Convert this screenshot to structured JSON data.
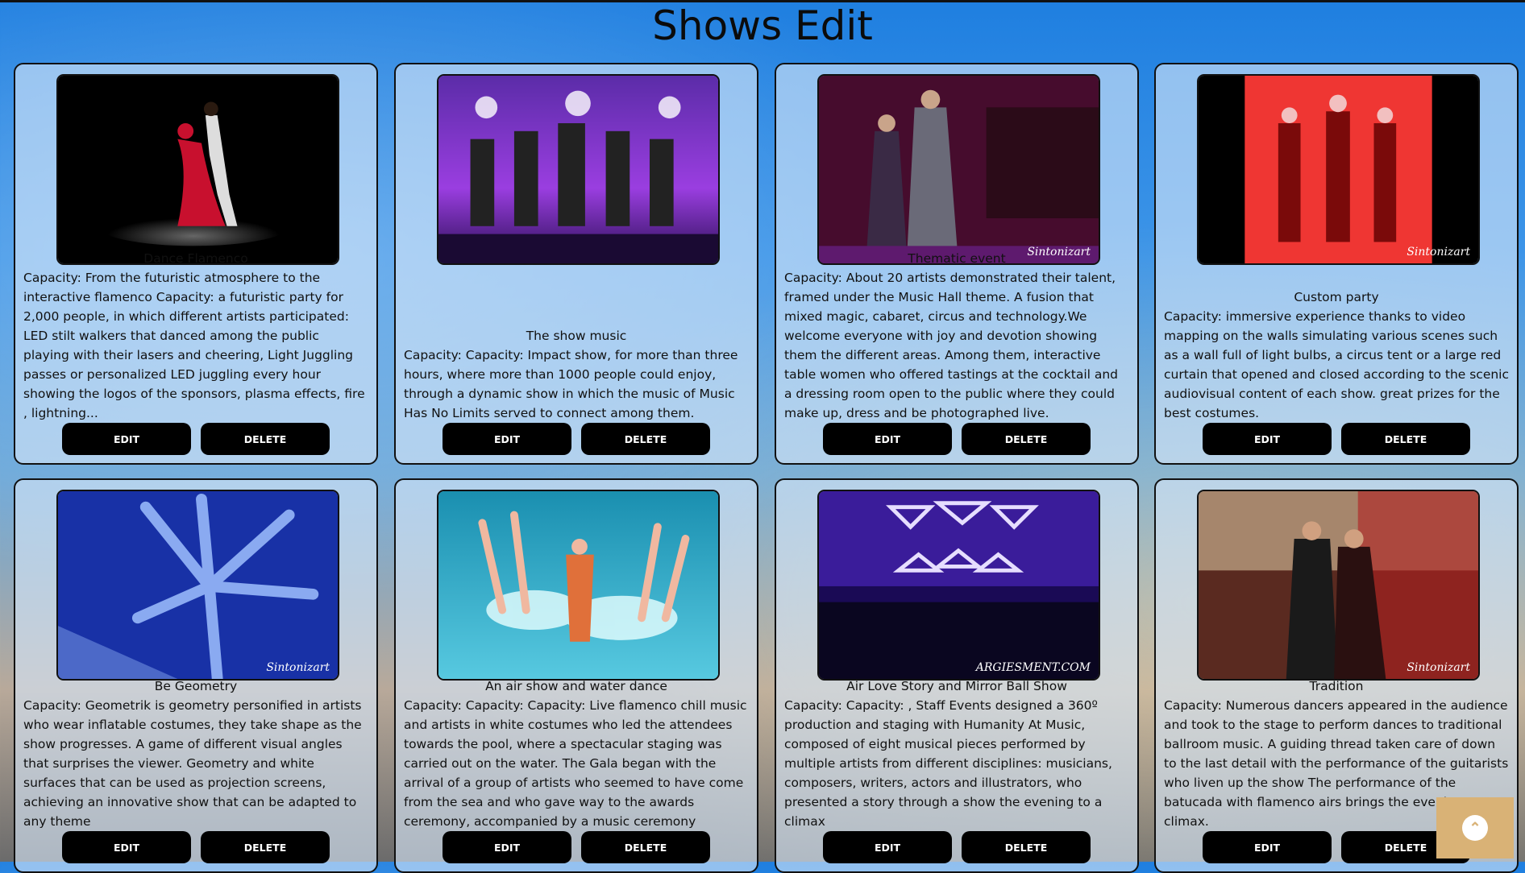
{
  "page": {
    "title": "Shows Edit"
  },
  "buttons": {
    "edit": "EDIT",
    "delete": "DELETE"
  },
  "shows": [
    {
      "name": "Dance Flamenco",
      "description": "Capacity: From the futuristic atmosphere to the interactive flamenco Capacity: a futuristic party for 2,000 people, in which different artists participated: LED stilt walkers that danced among the public playing with their lasers and cheering, Light Juggling passes or personalized LED juggling every hour showing the logos of the sponsors, plasma effects, fire , lightning...",
      "watermark": ""
    },
    {
      "name": "The show music",
      "description": "Capacity: Capacity: Impact show, for more than three hours, where more than 1000 people could enjoy, through a dynamic show in which the music of Music Has No Limits served to connect among them.",
      "watermark": ""
    },
    {
      "name": "Thematic event",
      "description": "Capacity: About 20 artists demonstrated their talent, framed under the Music Hall theme. A fusion that mixed magic, cabaret, circus and technology.We welcome everyone with joy and devotion showing them the different areas. Among them, interactive table women who offered tastings at the cocktail and a dressing room open to the public where they could make up, dress and be photographed live.",
      "watermark": "Sintonizart"
    },
    {
      "name": "Custom party",
      "description": "Capacity: immersive experience thanks to video mapping on the walls simulating various scenes such as a wall full of light bulbs, a circus tent or a large red curtain that opened and closed according to the scenic audiovisual content of each show. great prizes for the best costumes.",
      "watermark": "Sintonizart"
    },
    {
      "name": "Be Geometry",
      "description": "Capacity: Geometrik is geometry personified in artists who wear inflatable costumes, they take shape as the show progresses. A game of different visual angles that surprises the viewer. Geometry and white surfaces that can be used as projection screens, achieving an innovative show that can be adapted to any theme",
      "watermark": "Sintonizart"
    },
    {
      "name": "An air show and water dance",
      "description": "Capacity: Capacity: Capacity: Live flamenco chill music and artists in white costumes who led the attendees towards the pool, where a spectacular staging was carried out on the water. The Gala began with the arrival of a group of artists who seemed to have come from the sea and who gave way to the awards ceremony, accompanied by a music ceremony",
      "watermark": ""
    },
    {
      "name": "Air Love Story and Mirror Ball Show",
      "description": "Capacity: Capacity: , Staff Events designed a 360º production and staging with Humanity At Music, composed of eight musical pieces performed by multiple artists from different disciplines: musicians, composers, writers, actors and illustrators, who presented a story through a show the evening to a climax",
      "watermark": "ARGIESMENT.COM"
    },
    {
      "name": "Tradition",
      "description": "Capacity: Numerous dancers appeared in the audience and took to the stage to perform dances to traditional ballroom music. A guiding thread taken care of down to the last detail with the performance of the guitarists who liven up the show The performance of the batucada with flamenco airs brings the evening to a climax.",
      "watermark": "Sintonizart"
    }
  ],
  "icons": {
    "scroll_top": "chevron-up-icon"
  },
  "colors": {
    "button": "#000000",
    "scroll_top": "#d9b276"
  }
}
